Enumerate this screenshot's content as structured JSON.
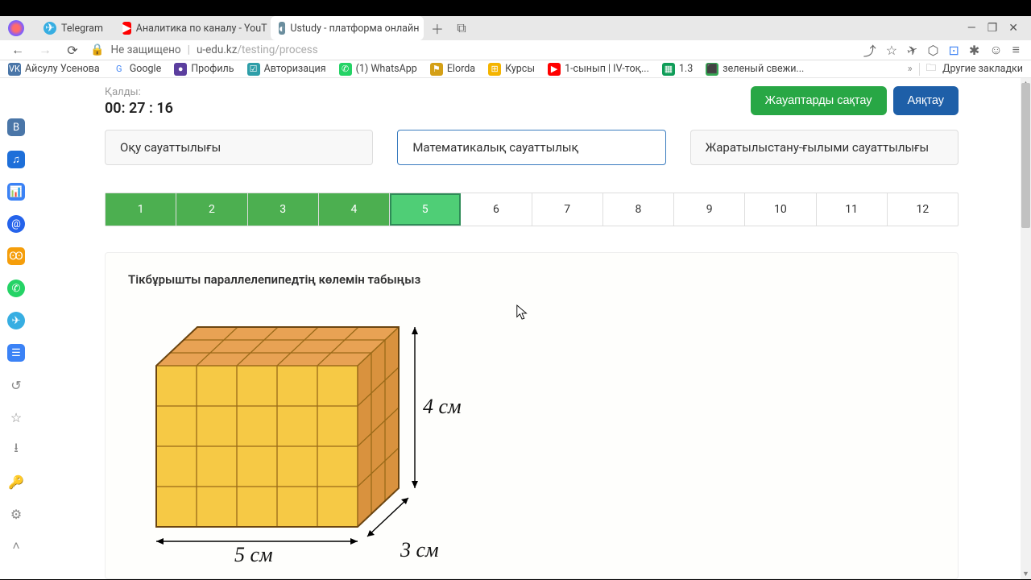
{
  "tabs": [
    {
      "label": "Telegram",
      "fav_color": "#37aee2",
      "fav_glyph": "✈"
    },
    {
      "label": "Аналитика по каналу - YouT",
      "fav_color": "#ff0000",
      "fav_glyph": "▶"
    },
    {
      "label": "Ustudy - платформа онлайн",
      "fav_color": "#6b8e9e",
      "fav_glyph": "◐"
    }
  ],
  "url": {
    "insecure_label": "Не защищено",
    "host": "u-edu.kz",
    "path": "/testing/process"
  },
  "bookmarks": [
    {
      "label": "Айсулу Усенова",
      "bg": "#4a76a8",
      "glyph": "VK"
    },
    {
      "label": "Google",
      "bg": "",
      "glyph": "G"
    },
    {
      "label": "Профиль",
      "bg": "#5b3e9e",
      "glyph": "●"
    },
    {
      "label": "Авторизация",
      "bg": "#2e9ea8",
      "glyph": "☑"
    },
    {
      "label": "(1) WhatsApp",
      "bg": "#25d366",
      "glyph": "✆"
    },
    {
      "label": "Elorda",
      "bg": "#d4a017",
      "glyph": "⚑"
    },
    {
      "label": "Курсы",
      "bg": "#f4b400",
      "glyph": "⊞"
    },
    {
      "label": "1-сынып | IV-тоқ...",
      "bg": "#ff0000",
      "glyph": "▶"
    },
    {
      "label": "1.3",
      "bg": "#0f9d58",
      "glyph": "▦"
    },
    {
      "label": "зеленый свежи...",
      "bg": "#34a853",
      "glyph": "⬛"
    }
  ],
  "bookmarks_other": "Другие закладки",
  "timer": {
    "label": "Қалды:",
    "value": "00: 27 : 16"
  },
  "actions": {
    "save": "Жауаптарды сақтау",
    "finish": "Аяқтау"
  },
  "sections": [
    {
      "label": "Оқу сауаттылығы",
      "active": false
    },
    {
      "label": "Математикалық сауаттылық",
      "active": true
    },
    {
      "label": "Жаратылыстану-ғылыми сауаттылығы",
      "active": false
    }
  ],
  "questions": [
    {
      "n": "1",
      "state": "done"
    },
    {
      "n": "2",
      "state": "done"
    },
    {
      "n": "3",
      "state": "done"
    },
    {
      "n": "4",
      "state": "done"
    },
    {
      "n": "5",
      "state": "current"
    },
    {
      "n": "6",
      "state": ""
    },
    {
      "n": "7",
      "state": ""
    },
    {
      "n": "8",
      "state": ""
    },
    {
      "n": "9",
      "state": ""
    },
    {
      "n": "10",
      "state": ""
    },
    {
      "n": "11",
      "state": ""
    },
    {
      "n": "12",
      "state": ""
    }
  ],
  "question": {
    "title": "Тікбұрышты параллелепипедтің көлемін табыңыз",
    "dim_w": "5 см",
    "dim_d": "3 см",
    "dim_h": "4 см"
  },
  "cuboid": {
    "width_units": 5,
    "depth_units": 3,
    "height_units": 4
  }
}
